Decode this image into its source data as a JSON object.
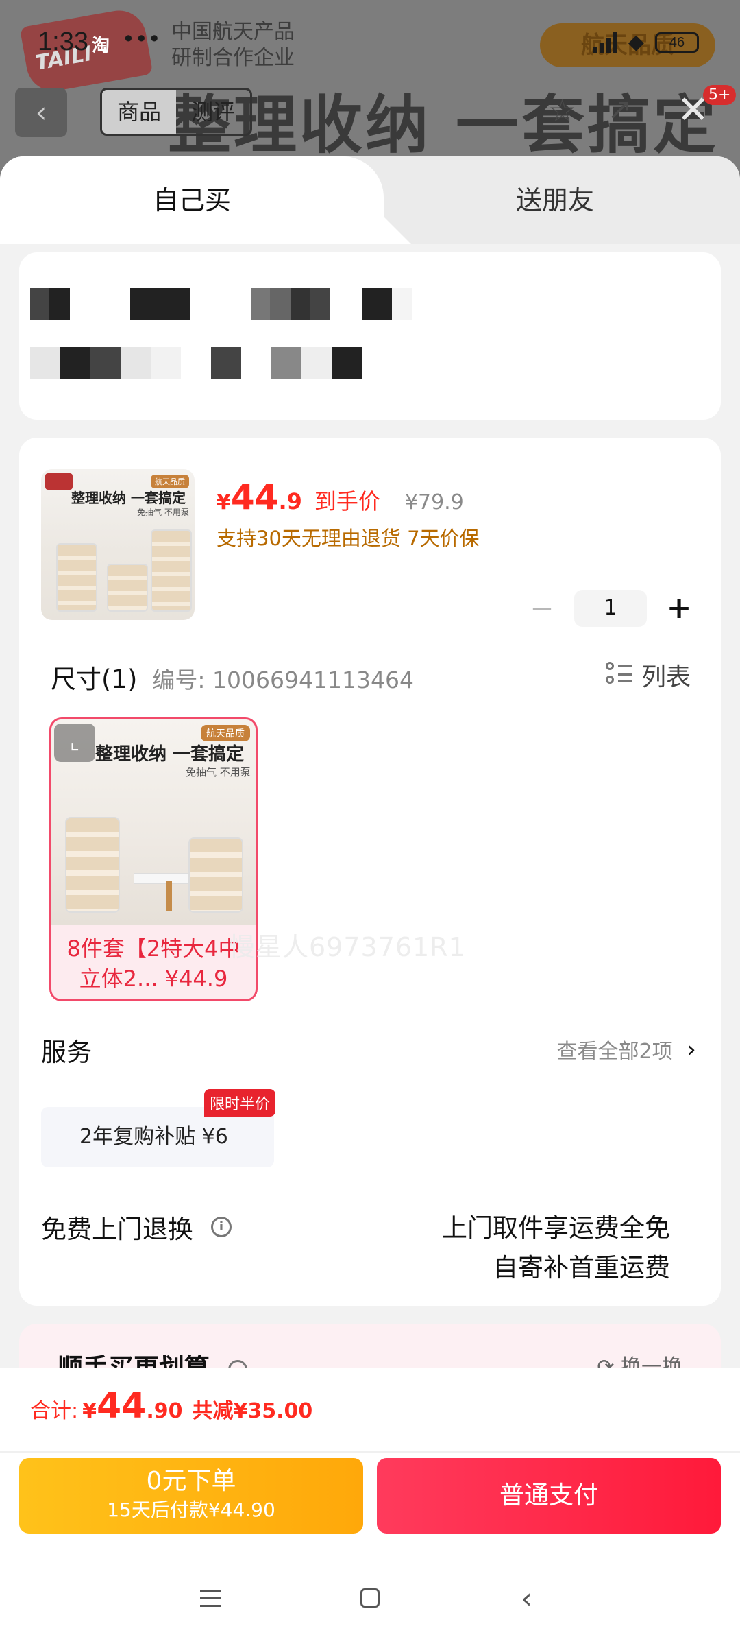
{
  "status": {
    "time": "1:33",
    "app_glyph": "淘",
    "dots": "•••",
    "battery": "46"
  },
  "background": {
    "logo_text": "TAILI",
    "company_line1": "中国航天产品",
    "company_line2": "研制合作企业",
    "badge": "航天品质",
    "banner": "整理收纳 一套搞定",
    "tab_product": "商品",
    "tab_review": "测评",
    "close": "✕",
    "message_count": "5+"
  },
  "mode_tabs": {
    "self": "自己买",
    "gift": "送朋友"
  },
  "product": {
    "price_symbol": "¥",
    "price_int": "44",
    "price_dec": ".9",
    "price_tag": "到手价",
    "original_price": "¥79.9",
    "guarantee": "支持30天无理由退货  7天价保",
    "quantity": "1",
    "thumb_title": "整理收纳 一套搞定",
    "thumb_sub": "免抽气 不用泵",
    "thumb_tag": "航天品质"
  },
  "spec": {
    "title": "尺寸(1)",
    "code": "编号: 10066941113464",
    "list_label": "列表",
    "sku_label": "8件套【2特大4中立体2...  ¥44.9",
    "watermark": "慢星人6973761R1"
  },
  "service": {
    "title": "服务",
    "more": "查看全部2项",
    "item": "2年复购补贴  ¥6",
    "badge": "限时半价"
  },
  "returns": {
    "title": "免费上门退换",
    "desc_line1": "上门取件享运费全免",
    "desc_line2": "自寄补首重运费"
  },
  "recommend": {
    "title": "顺手买更划算",
    "swap": "换一换"
  },
  "footer": {
    "total_label": "合计:",
    "total_symbol": "¥",
    "total_int": "44",
    "total_dec": ".90",
    "saving": "共减¥35.00",
    "credit_line1": "0元下单",
    "credit_line2": "15天后付款¥44.90",
    "pay": "普通支付"
  },
  "colors": {
    "accent_red": "#ff2a20",
    "guarantee_orange": "#b86a00",
    "pay_button": "#ff1a3a",
    "credit_button": "#ffb310"
  }
}
